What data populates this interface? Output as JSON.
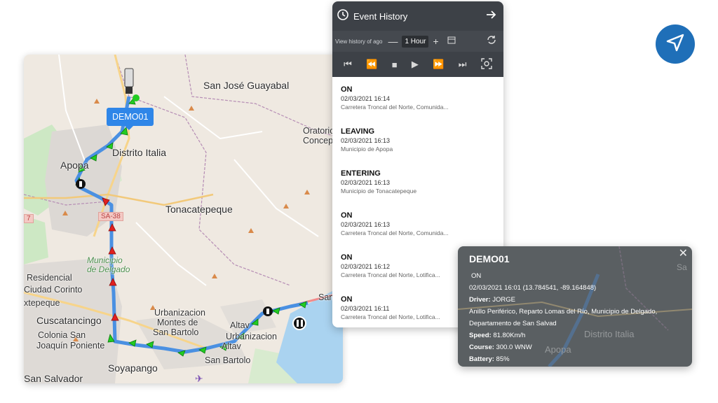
{
  "map": {
    "device_label": "DEMO01",
    "route_badge": "SA-38",
    "route_badge_left": "7",
    "labels": {
      "san_jose": "San José Guayabal",
      "distrito": "Distrito Italia",
      "apopa": "Apopa",
      "oratorio": "Oratorio",
      "concepc": "Concepc",
      "tonacatepeque": "Tonacatepeque",
      "municipio_de": "Municipio",
      "delgado": "de Delgado",
      "residencial": "Residencial",
      "ciudad_corinto": "Ciudad Corinto",
      "xtepeque": "xtepeque",
      "cuscatancingo": "Cuscatancingo",
      "colonia_san": "Colonia San",
      "joaquin": "Joaquín Poniente",
      "soyapango": "Soyapango",
      "san_salvador": "San Salvador",
      "urbanizacion1": "Urbanizacion",
      "montes": "Montes de",
      "san_bartolo1": "San Bartolo",
      "altavista": "Altav",
      "urbanizacion2": "Urbanizacion",
      "altav2": "Altav",
      "san_bartolo2": "San Bartolo",
      "san_ma": "San Ma"
    }
  },
  "history": {
    "title": "Event History",
    "view_label": "View history of ago",
    "period": "1 Hour",
    "events": [
      {
        "type": "ON",
        "time": "02/03/2021 16:14",
        "address": "Carretera Troncal del Norte, Comunida..."
      },
      {
        "type": "LEAVING",
        "time": "02/03/2021 16:13",
        "address": "Municipio de Apopa"
      },
      {
        "type": "ENTERING",
        "time": "02/03/2021 16:13",
        "address": "Municipio de Tonacatepeque"
      },
      {
        "type": "ON",
        "time": "02/03/2021 16:13",
        "address": "Carretera Troncal del Norte, Comunida..."
      },
      {
        "type": "ON",
        "time": "02/03/2021 16:12",
        "address": "Carretera Troncal del Norte, Lotifica..."
      },
      {
        "type": "ON",
        "time": "02/03/2021 16:11",
        "address": "Carretera Troncal del Norte, Lotifica..."
      }
    ]
  },
  "popup": {
    "title": "DEMO01",
    "status": "ON",
    "datetime": "02/03/2021 16:01 (13.784541, -89.164848)",
    "driver_label": "Driver:",
    "driver": "JORGE",
    "address_line1": "Anillo Periférico, Reparto Lomas del Río, Municipio de Delgado,",
    "address_line2": "Departamento de San Salvad",
    "speed_label": "Speed:",
    "speed": "81.80Km/h",
    "course_label": "Course:",
    "course": "300.0 WNW",
    "battery_label": "Battery:",
    "battery": "85%",
    "bg_labels": {
      "distrito": "Distrito Italia",
      "apopa": "Apopa",
      "sa": "Sa"
    }
  },
  "colors": {
    "accent": "#1f6fb8",
    "tag": "#2f86e8",
    "route": "#4a90e2",
    "arrow_green": "#22cc22",
    "arrow_red": "#e02020"
  }
}
